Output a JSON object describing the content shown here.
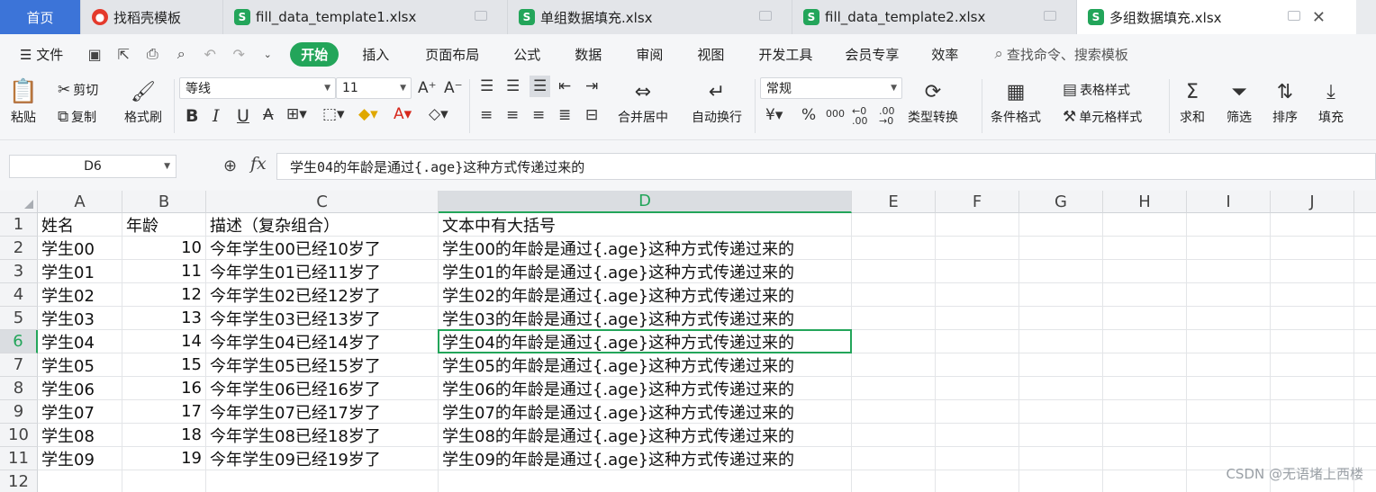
{
  "tabs": [
    {
      "label": "首页",
      "kind": "home"
    },
    {
      "label": "找稻壳模板",
      "kind": "docer"
    },
    {
      "label": "fill_data_template1.xlsx",
      "kind": "sheet"
    },
    {
      "label": "单组数据填充.xlsx",
      "kind": "sheet"
    },
    {
      "label": "fill_data_template2.xlsx",
      "kind": "sheet"
    },
    {
      "label": "多组数据填充.xlsx",
      "kind": "sheet",
      "active": true
    }
  ],
  "menu": {
    "file": "文件",
    "start": "开始",
    "items": [
      "插入",
      "页面布局",
      "公式",
      "数据",
      "审阅",
      "视图",
      "开发工具",
      "会员专享",
      "效率"
    ],
    "search": "查找命令、搜索模板"
  },
  "ribbon": {
    "paste": "粘贴",
    "cut": "剪切",
    "copy": "复制",
    "format_painter": "格式刷",
    "font_name": "等线",
    "font_size": "11",
    "merge": "合并居中",
    "wrap": "自动换行",
    "number_format": "常规",
    "type_convert": "类型转换",
    "cond_format": "条件格式",
    "table_style": "表格样式",
    "cell_style": "单元格样式",
    "sum": "求和",
    "filter": "筛选",
    "sort": "排序",
    "fill": "填充",
    "percent": "%",
    "thousands": "000",
    "dec_inc": "←0 .00",
    "dec_dec": ".00 →0"
  },
  "formula_bar": {
    "name_box": "D6",
    "fx": "fx",
    "content": "学生04的年龄是通过{.age}这种方式传递过来的"
  },
  "sheet": {
    "columns": [
      "A",
      "B",
      "C",
      "D",
      "E",
      "F",
      "G",
      "H",
      "I",
      "J"
    ],
    "selected_col": "D",
    "selected_row": "6",
    "rows": [
      {
        "n": "1",
        "a": "姓名",
        "b": "年龄",
        "c": "描述（复杂组合）",
        "d": "文本中有大括号"
      },
      {
        "n": "2",
        "a": "学生00",
        "b": "10",
        "c": "今年学生00已经10岁了",
        "d": "学生00的年龄是通过{.age}这种方式传递过来的"
      },
      {
        "n": "3",
        "a": "学生01",
        "b": "11",
        "c": "今年学生01已经11岁了",
        "d": "学生01的年龄是通过{.age}这种方式传递过来的"
      },
      {
        "n": "4",
        "a": "学生02",
        "b": "12",
        "c": "今年学生02已经12岁了",
        "d": "学生02的年龄是通过{.age}这种方式传递过来的"
      },
      {
        "n": "5",
        "a": "学生03",
        "b": "13",
        "c": "今年学生03已经13岁了",
        "d": "学生03的年龄是通过{.age}这种方式传递过来的"
      },
      {
        "n": "6",
        "a": "学生04",
        "b": "14",
        "c": "今年学生04已经14岁了",
        "d": "学生04的年龄是通过{.age}这种方式传递过来的"
      },
      {
        "n": "7",
        "a": "学生05",
        "b": "15",
        "c": "今年学生05已经15岁了",
        "d": "学生05的年龄是通过{.age}这种方式传递过来的"
      },
      {
        "n": "8",
        "a": "学生06",
        "b": "16",
        "c": "今年学生06已经16岁了",
        "d": "学生06的年龄是通过{.age}这种方式传递过来的"
      },
      {
        "n": "9",
        "a": "学生07",
        "b": "17",
        "c": "今年学生07已经17岁了",
        "d": "学生07的年龄是通过{.age}这种方式传递过来的"
      },
      {
        "n": "10",
        "a": "学生08",
        "b": "18",
        "c": "今年学生08已经18岁了",
        "d": "学生08的年龄是通过{.age}这种方式传递过来的"
      },
      {
        "n": "11",
        "a": "学生09",
        "b": "19",
        "c": "今年学生09已经19岁了",
        "d": "学生09的年龄是通过{.age}这种方式传递过来的"
      },
      {
        "n": "12",
        "a": "",
        "b": "",
        "c": "",
        "d": ""
      }
    ]
  },
  "watermark": "CSDN @无语堵上西楼",
  "colors": {
    "accent": "#23a55a",
    "home_tab": "#3c74d8"
  }
}
